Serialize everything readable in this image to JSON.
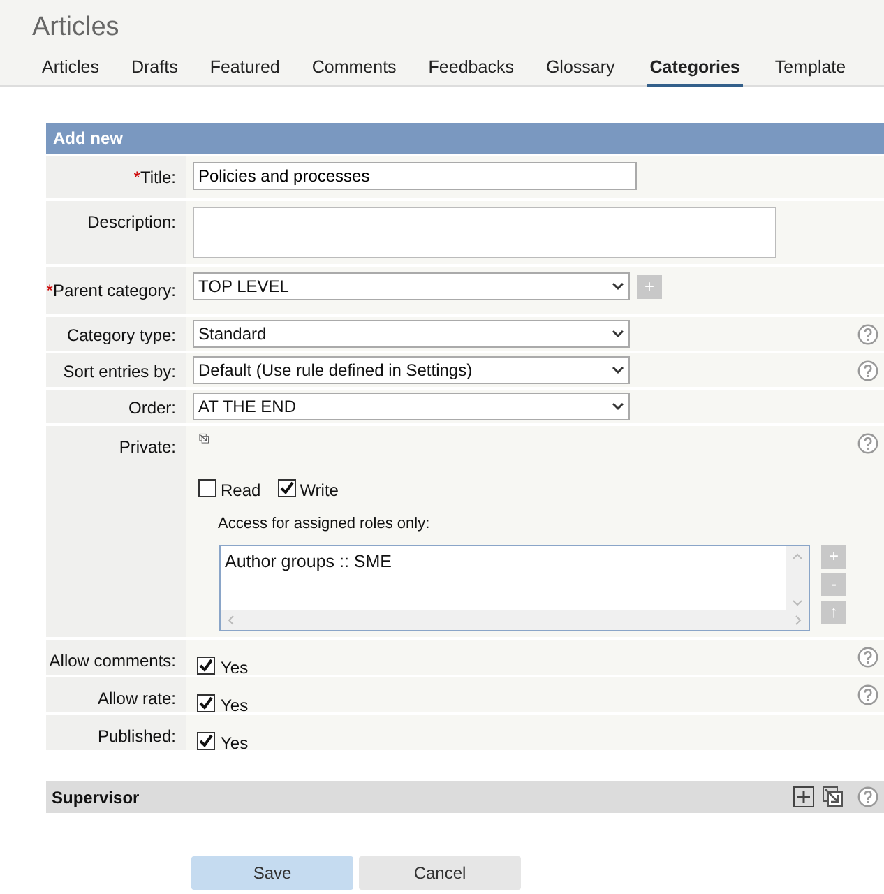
{
  "page_title": "Articles",
  "tabs": [
    {
      "label": "Articles",
      "selected": false
    },
    {
      "label": "Drafts",
      "selected": false
    },
    {
      "label": "Featured",
      "selected": false
    },
    {
      "label": "Comments",
      "selected": false
    },
    {
      "label": "Feedbacks",
      "selected": false
    },
    {
      "label": "Glossary",
      "selected": false
    },
    {
      "label": "Categories",
      "selected": true
    },
    {
      "label": "Template",
      "selected": false
    }
  ],
  "form": {
    "title": "Add new",
    "required_mark": "*",
    "fields": [
      {
        "kind": "text",
        "label": "Title:",
        "required": true,
        "help": false,
        "value": "Policies and processes"
      },
      {
        "kind": "textarea",
        "label": "Description:",
        "required": false,
        "help": false
      },
      {
        "kind": "select",
        "label": "Parent category:",
        "required": true,
        "help": false,
        "value": "TOP LEVEL",
        "add_button": "+"
      },
      {
        "kind": "select",
        "label": "Category type:",
        "required": false,
        "help": true,
        "value": "Standard"
      },
      {
        "kind": "select",
        "label": "Sort entries by:",
        "required": false,
        "help": true,
        "value": "Default (Use rule defined in Settings)"
      },
      {
        "kind": "select",
        "label": "Order:",
        "required": false,
        "help": false,
        "value": "AT THE END"
      },
      {
        "kind": "private",
        "label": "Private:",
        "required": false,
        "help": true,
        "permissions": [
          {
            "label": "Read",
            "checked": false
          },
          {
            "label": "Write",
            "checked": true
          }
        ],
        "access_label": "Access for assigned roles only:",
        "roles": [
          "Author groups :: SME"
        ],
        "role_buttons": [
          "+",
          "-",
          "↑"
        ]
      },
      {
        "kind": "checkbox",
        "label": "Allow comments:",
        "required": false,
        "help": true,
        "checked": true,
        "text": "Yes"
      },
      {
        "kind": "checkbox",
        "label": "Allow rate:",
        "required": false,
        "help": true,
        "checked": true,
        "text": "Yes"
      },
      {
        "kind": "checkbox",
        "label": "Published:",
        "required": false,
        "help": false,
        "checked": true,
        "text": "Yes"
      }
    ]
  },
  "supervisor": {
    "title": "Supervisor"
  },
  "buttons": [
    {
      "label": "Save",
      "kind": "primary"
    },
    {
      "label": "Cancel",
      "kind": "secondary"
    }
  ]
}
